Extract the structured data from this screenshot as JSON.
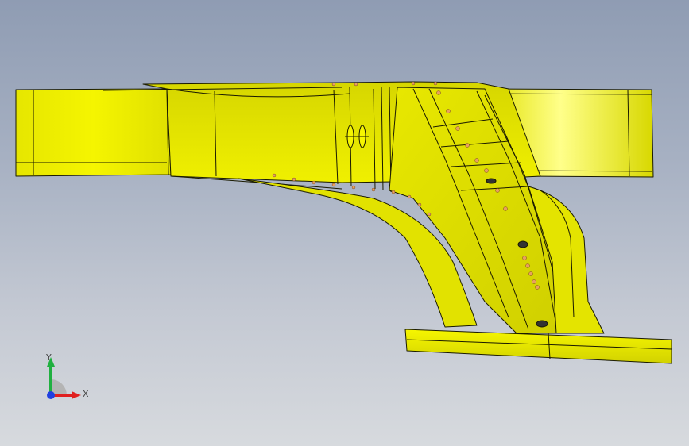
{
  "viewport": {
    "background_top": "#8f9cb3",
    "background_bottom": "#d7dade"
  },
  "model": {
    "name": "yellow-bracket-part",
    "color": "#f5f500",
    "edge_color": "#1a1a00",
    "weld_point_color": "#e8a060"
  },
  "triad": {
    "x_label": "X",
    "y_label": "Y",
    "x_color": "#e02020",
    "y_color": "#20b040",
    "z_color": "#2040e0"
  }
}
